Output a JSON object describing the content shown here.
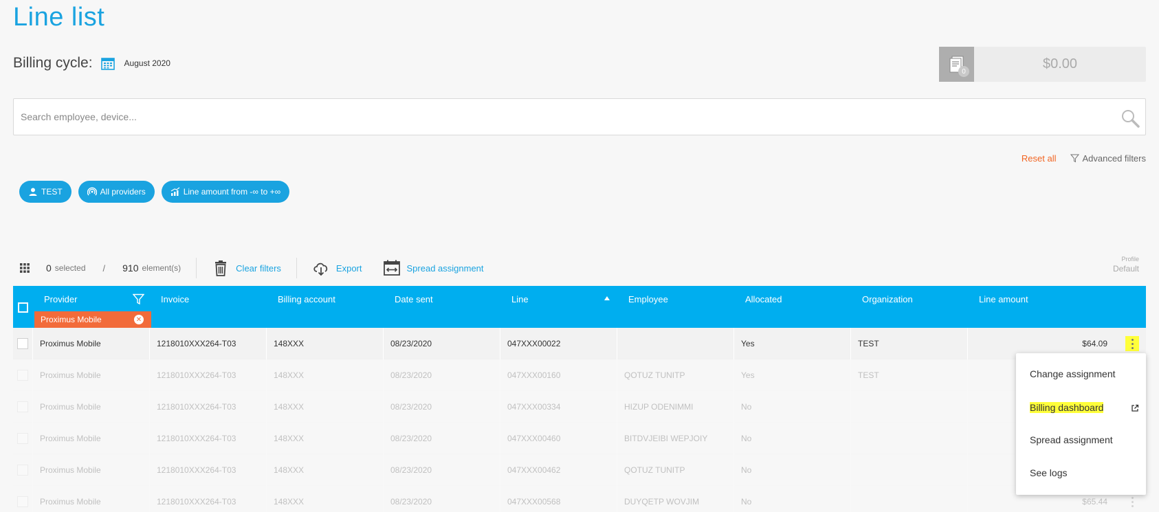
{
  "page": {
    "title": "Line list"
  },
  "billing": {
    "label": "Billing cycle:",
    "value": "August 2020"
  },
  "cart": {
    "count": "0",
    "amount": "$0.00"
  },
  "search": {
    "placeholder": "Search employee, device..."
  },
  "filters": {
    "reset_label": "Reset all",
    "advanced_label": "Advanced filters"
  },
  "chips": [
    {
      "label": "TEST",
      "icon": "user-icon"
    },
    {
      "label": "All providers",
      "icon": "antenna-icon"
    },
    {
      "label": "Line amount from -∞ to +∞",
      "icon": "chart-icon"
    }
  ],
  "toolbar": {
    "selected_count": "0",
    "selected_label": "selected",
    "slash": "/",
    "total_count": "910",
    "total_label": "element(s)",
    "clear_filters": "Clear filters",
    "export": "Export",
    "spread_assignment": "Spread assignment",
    "profile_label": "Profile",
    "profile_value": "Default"
  },
  "table": {
    "columns": [
      "Provider",
      "Invoice",
      "Billing account",
      "Date sent",
      "Line",
      "Employee",
      "Allocated",
      "Organization",
      "Line amount"
    ],
    "provider_filter_tag": "Proximus Mobile",
    "sort_column": "Line",
    "rows": [
      {
        "provider": "Proximus Mobile",
        "invoice": "1218010XXX264-T03",
        "account": "148XXX",
        "date": "08/23/2020",
        "line": "047XXX00022",
        "employee": "",
        "allocated": "Yes",
        "org": "TEST",
        "amount": "$64.09"
      },
      {
        "provider": "Proximus Mobile",
        "invoice": "1218010XXX264-T03",
        "account": "148XXX",
        "date": "08/23/2020",
        "line": "047XXX00160",
        "employee": "QOTUZ TUNITP",
        "allocated": "Yes",
        "org": "TEST",
        "amount": ""
      },
      {
        "provider": "Proximus Mobile",
        "invoice": "1218010XXX264-T03",
        "account": "148XXX",
        "date": "08/23/2020",
        "line": "047XXX00334",
        "employee": "HIZUP ODENIMMI",
        "allocated": "No",
        "org": "",
        "amount": ""
      },
      {
        "provider": "Proximus Mobile",
        "invoice": "1218010XXX264-T03",
        "account": "148XXX",
        "date": "08/23/2020",
        "line": "047XXX00460",
        "employee": "BITDVJEIBI WEPJOIY",
        "allocated": "No",
        "org": "",
        "amount": ""
      },
      {
        "provider": "Proximus Mobile",
        "invoice": "1218010XXX264-T03",
        "account": "148XXX",
        "date": "08/23/2020",
        "line": "047XXX00462",
        "employee": "QOTUZ TUNITP",
        "allocated": "No",
        "org": "",
        "amount": ""
      },
      {
        "provider": "Proximus Mobile",
        "invoice": "1218010XXX264-T03",
        "account": "148XXX",
        "date": "08/23/2020",
        "line": "047XXX00568",
        "employee": "DUYQETP WOVJIM",
        "allocated": "No",
        "org": "",
        "amount": "$65.44"
      }
    ]
  },
  "context_menu": {
    "items": [
      "Change assignment",
      "Billing dashboard",
      "Spread assignment",
      "See logs"
    ]
  },
  "colors": {
    "accent": "#00aeef",
    "orange": "#f26b3a",
    "highlight": "#ffff3a"
  }
}
